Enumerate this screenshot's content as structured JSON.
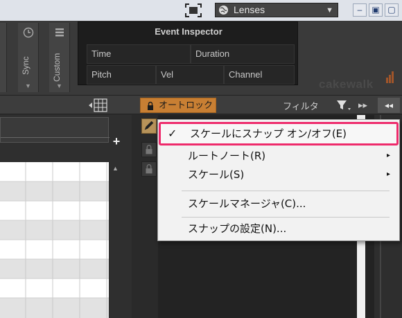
{
  "window": {
    "lens_dropdown": {
      "label": "Lenses",
      "icon": "globe-icon"
    },
    "buttons": {
      "minimize": "–",
      "restore": "▣",
      "close": "▢"
    }
  },
  "control_bar": {
    "modules": [
      {
        "label": "Sync",
        "icon": "clock-icon"
      },
      {
        "label": "Custom",
        "icon": "list-icon"
      }
    ],
    "event_inspector": {
      "title": "Event Inspector",
      "fields": {
        "time": "Time",
        "duration": "Duration",
        "pitch": "Pitch",
        "vel": "Vel",
        "channel": "Channel"
      }
    },
    "brand": "cakewalk"
  },
  "toolbar": {
    "autolock_label": "オートロック",
    "filter_label": "フィルタ",
    "ff_label": "▸▸",
    "rewind_label": "◂◂"
  },
  "piano_roll": {
    "add_label": "+",
    "scroll_label": "▲"
  },
  "context_menu": {
    "items": [
      {
        "label": "スケールにスナップ オン/オフ(E)",
        "checked": true,
        "submenu": false
      },
      {
        "label": "ルートノート(R)",
        "checked": false,
        "submenu": true
      },
      {
        "label": "スケール(S)",
        "checked": false,
        "submenu": true
      },
      {
        "label": "スケールマネージャ(C)...",
        "checked": false,
        "submenu": false
      },
      {
        "label": "スナップの設定(N)...",
        "checked": false,
        "submenu": false
      }
    ],
    "check_mark": "✓",
    "submenu_arrow": "▸"
  },
  "colors": {
    "highlight_border": "#ee2a6b",
    "autolock_bg": "#c87f33",
    "panel_bg": "#2b2b2b"
  }
}
